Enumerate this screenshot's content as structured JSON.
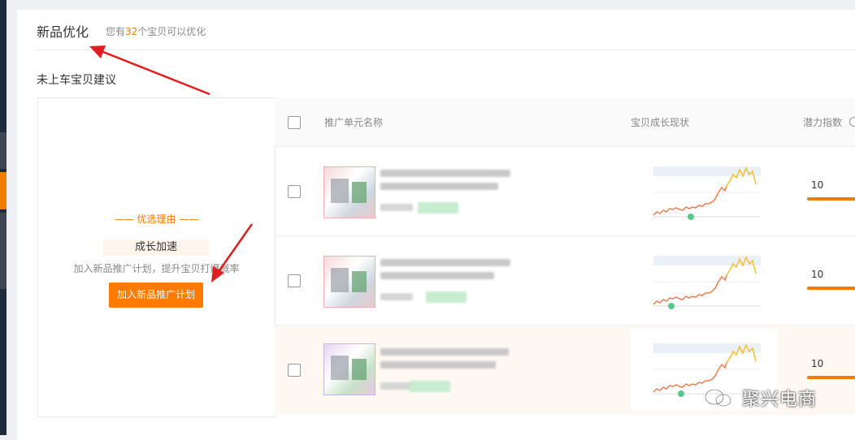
{
  "header": {
    "title": "新品优化",
    "subtitle_prefix": "您有",
    "subtitle_count": "32",
    "subtitle_suffix": "个宝贝可以优化"
  },
  "section": {
    "title": "未上车宝贝建议"
  },
  "left_panel": {
    "reason_heading": "—— 优选理由 ——",
    "reason_name": "成长加速",
    "reason_desc": "加入新品推广计划，提升宝贝打爆概率",
    "button_label": "加入新品推广计划"
  },
  "table": {
    "columns": [
      "推广单元名称",
      "宝贝成长现状",
      "潜力指数"
    ],
    "rows": [
      {
        "score": "10",
        "highlighted": false
      },
      {
        "score": "10",
        "highlighted": false
      },
      {
        "score": "10",
        "highlighted": true
      }
    ]
  },
  "watermark": "聚兴电商",
  "colors": {
    "accent": "#f07c00",
    "button": "#ff7a00",
    "arrow": "#e02020"
  }
}
